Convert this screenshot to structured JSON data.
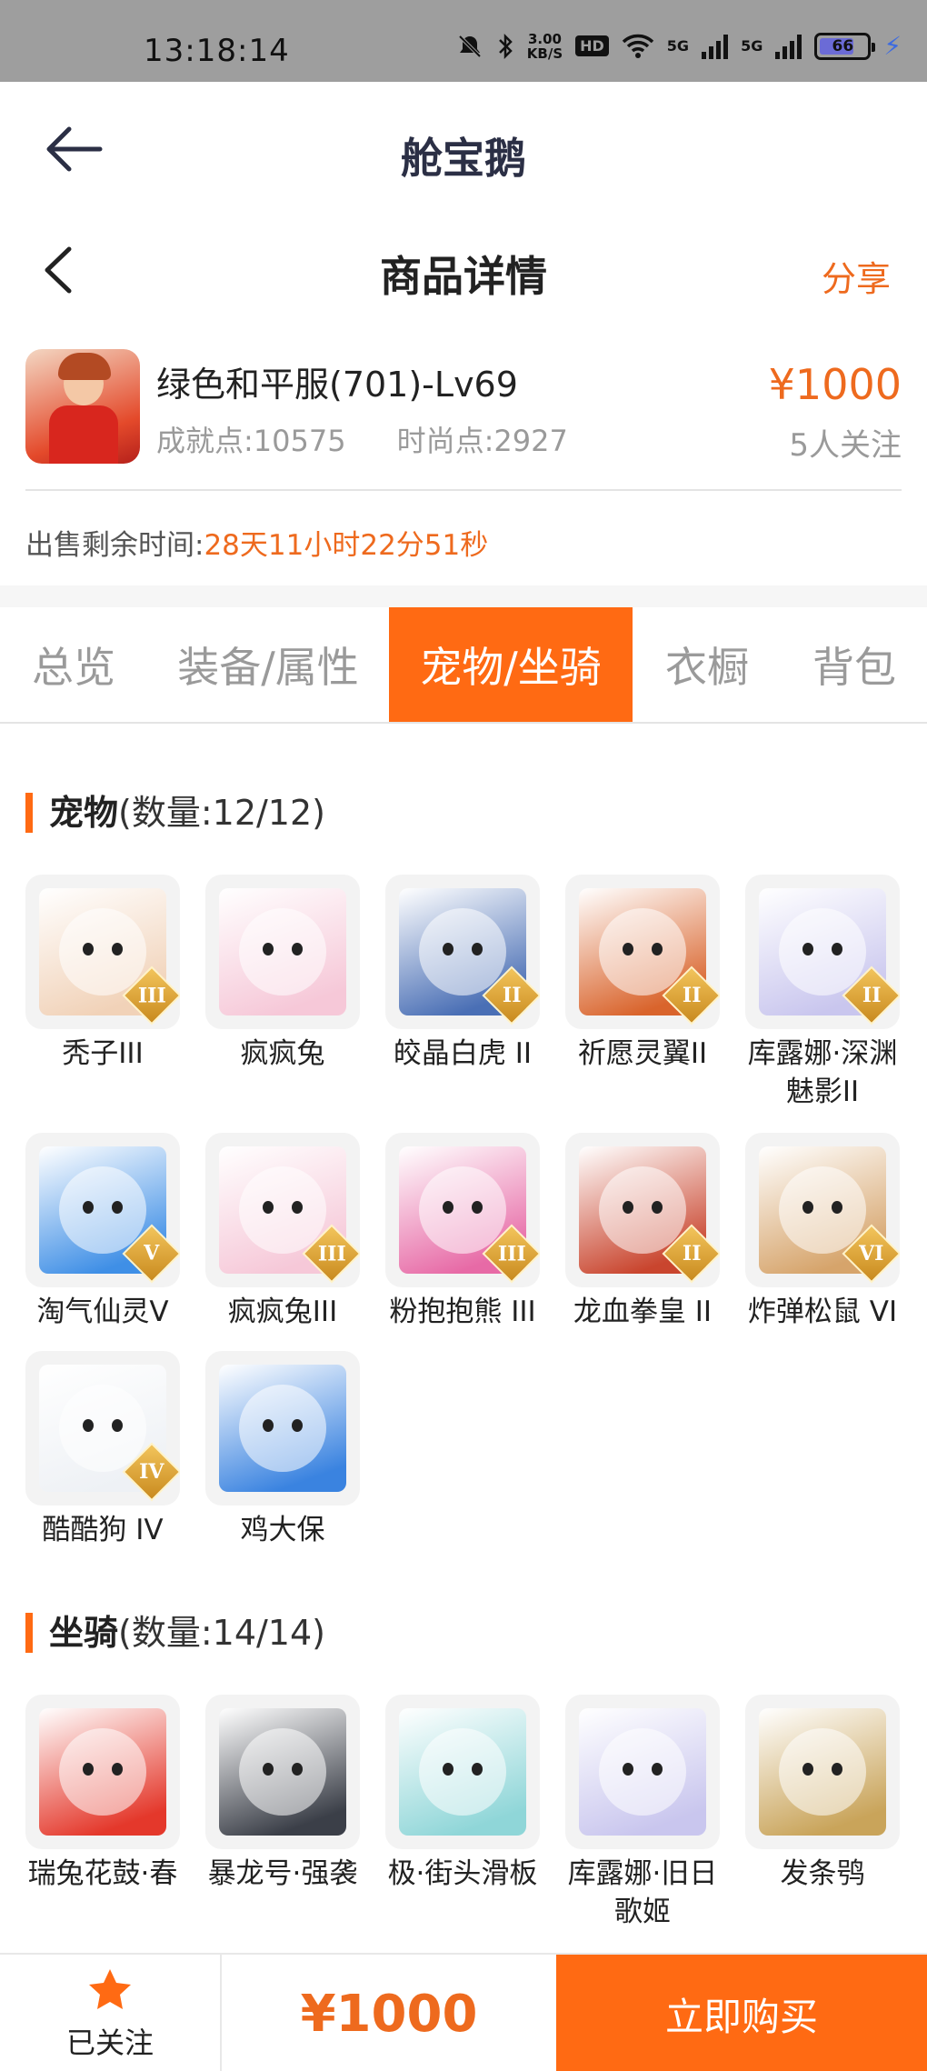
{
  "status_bar": {
    "time": "13:18:14",
    "speed_value": "3.00",
    "speed_unit": "KB/S",
    "hd_label": "HD",
    "network1": "5G",
    "network2": "5G",
    "battery": "66"
  },
  "app": {
    "title": "舱宝鹅"
  },
  "detail": {
    "title": "商品详情",
    "share_label": "分享"
  },
  "product": {
    "name": "绿色和平服(701)-Lv69",
    "achievement": "成就点:10575",
    "fashion": "时尚点:2927",
    "price": "¥1000",
    "followers": "5人关注",
    "remain_label": "出售剩余时间:",
    "remain_value": "28天11小时22分51秒"
  },
  "tabs": [
    {
      "label": "总览",
      "active": false
    },
    {
      "label": "装备/属性",
      "active": false
    },
    {
      "label": "宠物/坐骑",
      "active": true
    },
    {
      "label": "衣橱",
      "active": false
    },
    {
      "label": "背包",
      "active": false
    }
  ],
  "pets_section": {
    "title": "宠物",
    "count": "(数量:12/12)"
  },
  "pets": [
    {
      "name": "秃子III",
      "badge": "III",
      "icon": "bald-kid-icon",
      "color": "#f1d2b8"
    },
    {
      "name": "疯疯兔",
      "badge": "",
      "icon": "pink-rabbit-icon",
      "color": "#f6c8d8"
    },
    {
      "name": "皎晶白虎 II",
      "badge": "II",
      "icon": "white-tiger-icon",
      "color": "#4a6fb5"
    },
    {
      "name": "祈愿灵翼II",
      "badge": "II",
      "icon": "eagle-icon",
      "color": "#d9642c"
    },
    {
      "name": "库露娜·深渊魅影II",
      "badge": "II",
      "icon": "kuluna-icon",
      "color": "#c9c6ee"
    },
    {
      "name": "淘气仙灵V",
      "badge": "V",
      "icon": "blue-dog-icon",
      "color": "#3f8fe6"
    },
    {
      "name": "疯疯兔III",
      "badge": "III",
      "icon": "pink-rabbit-icon",
      "color": "#f6c8d8"
    },
    {
      "name": "粉抱抱熊 III",
      "badge": "III",
      "icon": "pink-bear-icon",
      "color": "#e76aa6"
    },
    {
      "name": "龙血拳皇 II",
      "badge": "II",
      "icon": "dragon-icon",
      "color": "#c9452e"
    },
    {
      "name": "炸弹松鼠 VI",
      "badge": "VI",
      "icon": "squirrel-icon",
      "color": "#d6a46b"
    },
    {
      "name": "酷酷狗 IV",
      "badge": "IV",
      "icon": "goggle-dog-icon",
      "color": "#eef1f5"
    },
    {
      "name": "鸡大保",
      "badge": "",
      "icon": "blue-chicken-icon",
      "color": "#3a83e0"
    }
  ],
  "mounts_section": {
    "title": "坐骑",
    "count": "(数量:14/14)"
  },
  "mounts": [
    {
      "name": "瑞兔花鼓·春",
      "icon": "drum-icon",
      "color": "#e4382b"
    },
    {
      "name": "暴龙号·强袭",
      "icon": "mecha-dragon-icon",
      "color": "#3b3f48"
    },
    {
      "name": "极·街头滑板",
      "icon": "skateboard-icon",
      "color": "#8fd6d8"
    },
    {
      "name": "库露娜·旧日歌姬",
      "icon": "kuluna-icon",
      "color": "#c9c6ee"
    },
    {
      "name": "发条鸮",
      "icon": "owl-icon",
      "color": "#c9a45a"
    }
  ],
  "bottom": {
    "follow_label": "已关注",
    "price": "¥1000",
    "buy_label": "立即购买"
  },
  "colors": {
    "accent": "#ff6a13",
    "price": "#ee6a1e",
    "status_bar": "#9e9e9e"
  }
}
